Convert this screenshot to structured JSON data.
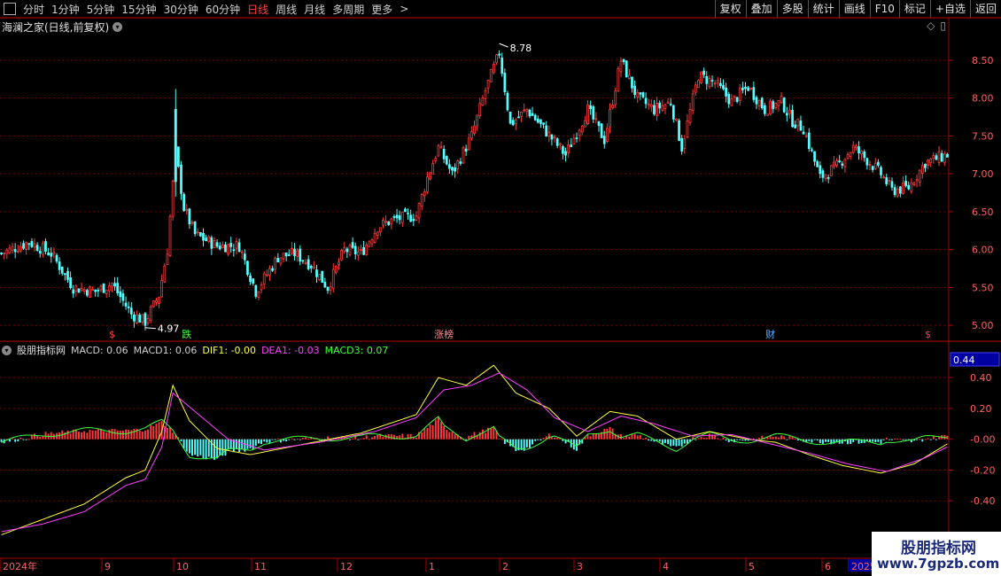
{
  "toolbar": {
    "periods": [
      "分时",
      "1分钟",
      "5分钟",
      "15分钟",
      "30分钟",
      "60分钟",
      "日线",
      "周线",
      "月线",
      "多周期",
      "更多"
    ],
    "active": "日线",
    "more_arrow": ">",
    "buttons": [
      "复权",
      "叠加",
      "多股",
      "统计",
      "画线",
      "F10",
      "标记",
      "+自选",
      "返回"
    ]
  },
  "stock_title": "海澜之家(日线,前复权)",
  "indicator_title": {
    "name": "股朋指标网",
    "items": [
      {
        "text": "MACD: 0.06",
        "color": "#d0d0d0"
      },
      {
        "text": "MACD1: 0.06",
        "color": "#d0d0d0"
      },
      {
        "text": "DIF1: -0.00",
        "color": "#ffff40"
      },
      {
        "text": "DEA1: -0.03",
        "color": "#ff40ff"
      },
      {
        "text": "MACD3: 0.07",
        "color": "#40ff40"
      }
    ]
  },
  "colors": {
    "up": "#ff3a3a",
    "down": "#54ffff",
    "grid": "#7a0000",
    "axis": "#b00000",
    "dif": "#ffff40",
    "dea": "#ff40ff",
    "macd3": "#40ff40"
  },
  "chart_data": [
    {
      "type": "candlestick",
      "title": "海澜之家(日线,前复权)",
      "ylim": [
        4.85,
        8.85
      ],
      "yticks": [
        "8.50",
        "8.00",
        "7.50",
        "7.00",
        "6.50",
        "6.00",
        "5.50",
        "5.00"
      ],
      "high_label": "8.78",
      "low_label": "4.97",
      "markers": [
        {
          "text": "$",
          "color": "#ff4040"
        },
        {
          "text": "跌",
          "color": "#40ff40"
        },
        {
          "text": "涨榜",
          "color": "#ff9090"
        },
        {
          "text": "财",
          "color": "#60b0ff"
        },
        {
          "text": "$",
          "color": "#ff4040"
        }
      ],
      "close_anchors": [
        [
          0,
          5.95
        ],
        [
          10,
          6.1
        ],
        [
          18,
          5.95
        ],
        [
          26,
          5.5
        ],
        [
          34,
          5.45
        ],
        [
          40,
          5.55
        ],
        [
          47,
          5.15
        ],
        [
          52,
          5.05
        ],
        [
          57,
          5.4
        ],
        [
          60,
          6.0
        ],
        [
          63,
          7.3
        ],
        [
          66,
          6.55
        ],
        [
          70,
          6.2
        ],
        [
          78,
          6.05
        ],
        [
          86,
          6.05
        ],
        [
          92,
          5.45
        ],
        [
          100,
          5.9
        ],
        [
          106,
          5.95
        ],
        [
          112,
          5.8
        ],
        [
          118,
          5.5
        ],
        [
          124,
          6.0
        ],
        [
          130,
          5.95
        ],
        [
          136,
          6.3
        ],
        [
          142,
          6.4
        ],
        [
          150,
          6.45
        ],
        [
          154,
          6.95
        ],
        [
          158,
          7.35
        ],
        [
          163,
          7.0
        ],
        [
          170,
          7.5
        ],
        [
          175,
          8.1
        ],
        [
          180,
          8.6
        ],
        [
          184,
          7.65
        ],
        [
          190,
          7.85
        ],
        [
          196,
          7.6
        ],
        [
          204,
          7.25
        ],
        [
          212,
          7.85
        ],
        [
          218,
          7.45
        ],
        [
          224,
          8.5
        ],
        [
          230,
          8.0
        ],
        [
          236,
          7.85
        ],
        [
          242,
          7.95
        ],
        [
          246,
          7.35
        ],
        [
          252,
          8.3
        ],
        [
          258,
          8.2
        ],
        [
          264,
          7.95
        ],
        [
          270,
          8.15
        ],
        [
          276,
          7.85
        ],
        [
          282,
          7.95
        ],
        [
          286,
          7.7
        ],
        [
          290,
          7.6
        ],
        [
          296,
          6.95
        ],
        [
          302,
          7.1
        ],
        [
          308,
          7.35
        ],
        [
          314,
          7.15
        ],
        [
          318,
          7.0
        ],
        [
          322,
          6.78
        ],
        [
          328,
          6.82
        ],
        [
          334,
          7.15
        ],
        [
          338,
          7.2
        ],
        [
          342,
          7.25
        ]
      ],
      "ohlc_note": "daily candles 2024-08 to 2025-06"
    },
    {
      "type": "line",
      "yticks": [
        "0.40",
        "0.20",
        "-0.00",
        "-0.20",
        "-0.40"
      ],
      "ylim": [
        -0.6,
        0.55
      ],
      "current_value_label": "0.44",
      "x_labels": [
        "2024年",
        "9",
        "10",
        "11",
        "12",
        "1",
        "2",
        "3",
        "4",
        "5",
        "6",
        "2025"
      ],
      "series": [
        {
          "name": "DIF1",
          "color": "#ffff40",
          "anchors": [
            [
              0,
              -0.62
            ],
            [
              15,
              -0.52
            ],
            [
              30,
              -0.42
            ],
            [
              45,
              -0.25
            ],
            [
              52,
              -0.2
            ],
            [
              58,
              0.05
            ],
            [
              62,
              0.35
            ],
            [
              68,
              0.12
            ],
            [
              78,
              -0.06
            ],
            [
              90,
              -0.1
            ],
            [
              110,
              -0.03
            ],
            [
              130,
              0.04
            ],
            [
              140,
              0.1
            ],
            [
              150,
              0.16
            ],
            [
              158,
              0.4
            ],
            [
              168,
              0.35
            ],
            [
              178,
              0.48
            ],
            [
              186,
              0.3
            ],
            [
              198,
              0.2
            ],
            [
              208,
              0.02
            ],
            [
              220,
              0.18
            ],
            [
              230,
              0.15
            ],
            [
              244,
              0.0
            ],
            [
              256,
              0.05
            ],
            [
              270,
              0.0
            ],
            [
              280,
              -0.02
            ],
            [
              292,
              -0.1
            ],
            [
              304,
              -0.17
            ],
            [
              318,
              -0.22
            ],
            [
              330,
              -0.16
            ],
            [
              342,
              -0.03
            ]
          ]
        },
        {
          "name": "DEA1",
          "color": "#ff40ff",
          "anchors": [
            [
              0,
              -0.6
            ],
            [
              15,
              -0.55
            ],
            [
              30,
              -0.47
            ],
            [
              45,
              -0.3
            ],
            [
              52,
              -0.26
            ],
            [
              58,
              -0.05
            ],
            [
              62,
              0.3
            ],
            [
              72,
              0.15
            ],
            [
              82,
              0.0
            ],
            [
              95,
              -0.07
            ],
            [
              115,
              -0.02
            ],
            [
              135,
              0.05
            ],
            [
              150,
              0.14
            ],
            [
              160,
              0.32
            ],
            [
              170,
              0.35
            ],
            [
              180,
              0.43
            ],
            [
              190,
              0.32
            ],
            [
              200,
              0.14
            ],
            [
              212,
              0.05
            ],
            [
              224,
              0.15
            ],
            [
              236,
              0.1
            ],
            [
              250,
              0.02
            ],
            [
              264,
              0.03
            ],
            [
              278,
              -0.03
            ],
            [
              292,
              -0.09
            ],
            [
              306,
              -0.16
            ],
            [
              320,
              -0.21
            ],
            [
              334,
              -0.12
            ],
            [
              342,
              -0.05
            ]
          ]
        }
      ]
    }
  ]
}
